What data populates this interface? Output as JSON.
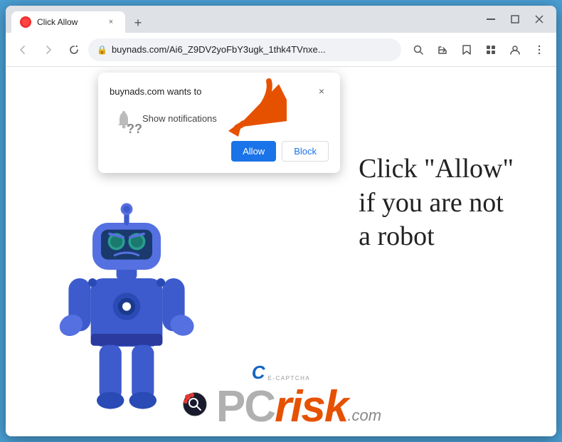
{
  "window": {
    "title": "Click Allow",
    "favicon": "red-circle",
    "close_label": "✕",
    "minimize_label": "—",
    "maximize_label": "□"
  },
  "address_bar": {
    "url": "buynads.com/Ai6_Z9DV2yoFbY3ugk_1thk4TVnxe...",
    "lock_icon": "🔒",
    "back_icon": "←",
    "forward_icon": "→",
    "refresh_icon": "↻",
    "search_icon": "🔍",
    "share_icon": "↗",
    "bookmark_icon": "☆",
    "extensions_icon": "⊞",
    "profile_icon": "👤",
    "menu_icon": "⋮"
  },
  "popup": {
    "site_text": "buynads.com wants to",
    "notification_label": "Show notifications",
    "close_icon": "×",
    "allow_button": "Allow",
    "block_button": "Block"
  },
  "page": {
    "main_text_line1": "Click \"Allow\"",
    "main_text_line2": "if you are not",
    "main_text_line3": "a robot"
  },
  "watermark": {
    "ecaptcha_letter": "C",
    "ecaptcha_label": "E-CAPTCHA",
    "pcrisk_pc": "PC",
    "pcrisk_risk": "risk",
    "pcrisk_dotcom": ".com"
  },
  "colors": {
    "browser_bg": "#dee1e6",
    "page_bg": "#ffffff",
    "allow_btn": "#1a73e8",
    "block_btn": "#ffffff",
    "arrow_color": "#e65100",
    "robot_body": "#3d5bcc",
    "text_color": "#222222"
  }
}
